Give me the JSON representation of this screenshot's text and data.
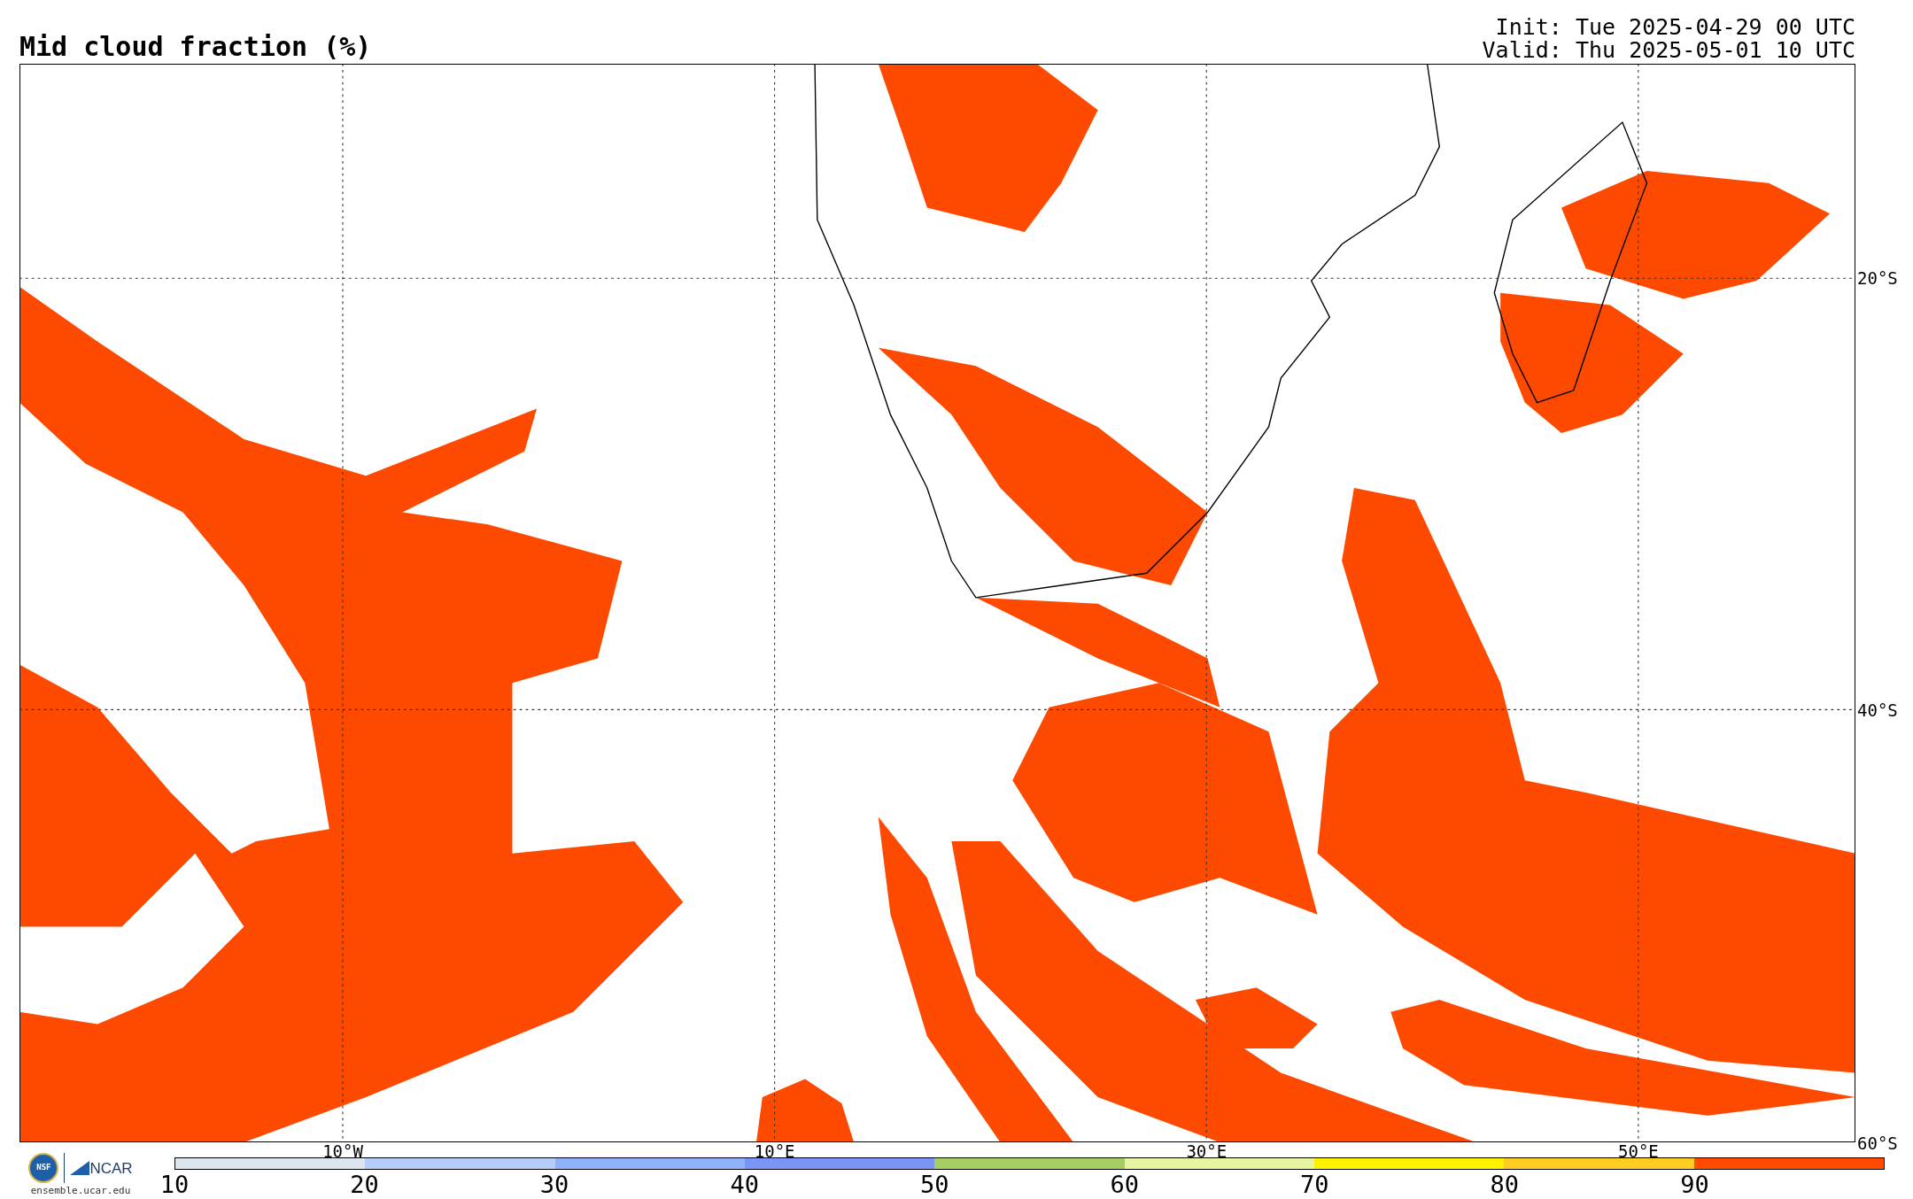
{
  "title": "Mid cloud fraction (%)",
  "init": "Init: Tue 2025-04-29 00 UTC",
  "valid": "Valid: Thu 2025-05-01 10 UTC",
  "map": {
    "lon_labels": [
      "10°W",
      "10°E",
      "30°E",
      "50°E"
    ],
    "lat_labels": [
      "20°S",
      "40°S",
      "60°S"
    ]
  },
  "logos": {
    "nsf": "NSF",
    "ncar": "NCAR",
    "url": "ensemble.ucar.edu"
  },
  "colorbar": {
    "segments": [
      {
        "color": "#dde6ee"
      },
      {
        "color": "#b5cdf8"
      },
      {
        "color": "#8fb1f8"
      },
      {
        "color": "#7b94f5"
      },
      {
        "color": "#a6cf63"
      },
      {
        "color": "#e8f5a0"
      },
      {
        "color": "#fff200"
      },
      {
        "color": "#ffcc22"
      },
      {
        "color": "#ff4a00"
      }
    ],
    "ticks": [
      "10",
      "20",
      "30",
      "40",
      "50",
      "60",
      "70",
      "80",
      "90"
    ]
  }
}
